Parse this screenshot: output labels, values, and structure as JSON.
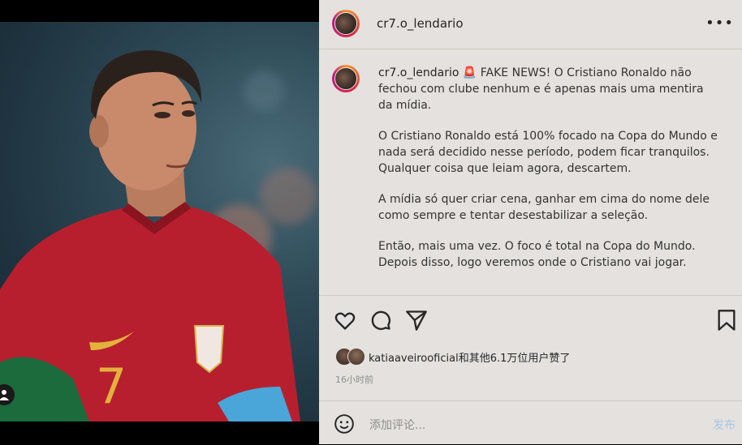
{
  "post": {
    "username": "cr7.o_lendario",
    "more_label": "•••",
    "caption": {
      "username": "cr7.o_lendario",
      "line1": " 🚨 FAKE NEWS! O Cristiano Ronaldo não fechou com clube nenhum e é apenas mais uma mentira da mídia.",
      "p2": "O Cristiano Ronaldo está 100% focado na Copa do Mundo e nada será decidido nesse período, podem ficar tranquilos. Qualquer coisa que leiam agora, descartem.",
      "p3": "A mídia só quer criar cena, ganhar em cima do nome dele como sempre e tentar desestabilizar a seleção.",
      "p4": "Então, mais uma vez. O foco é total na Copa do Mundo. Depois disso, logo veremos onde o Cristiano vai jogar."
    },
    "likes_text": "katiaaveirooficial和其他6.1万位用户赞了",
    "timestamp": "16小时前",
    "comment_placeholder": "添加评论...",
    "post_button": "发布",
    "photo": {
      "jersey_number": "7",
      "alt": "photo"
    }
  },
  "icons": [
    "heart-icon",
    "comment-icon",
    "share-icon",
    "bookmark-icon",
    "emoji-icon",
    "user-tag-icon"
  ],
  "colors": {
    "panel": "#e4e1de",
    "post_button": "#a6c7e6",
    "jersey_red": "#b81f2e",
    "jersey_green": "#1b6b3c"
  }
}
